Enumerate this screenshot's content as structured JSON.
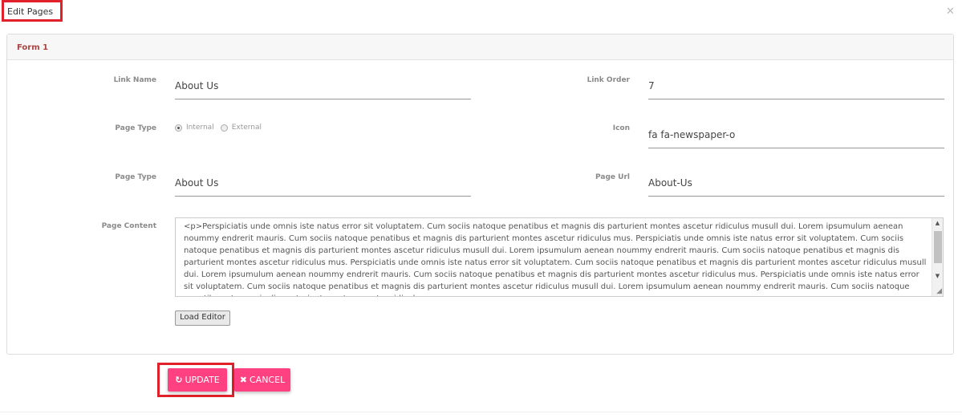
{
  "modal": {
    "title": "Edit Pages",
    "close_icon": "close-icon"
  },
  "panel": {
    "heading": "Form 1"
  },
  "form": {
    "link_name_label": "Link Name",
    "link_name_value": "About Us",
    "link_order_label": "Link Order",
    "link_order_value": "7",
    "page_type_label": "Page Type",
    "page_type_options": [
      "Internal",
      "External"
    ],
    "page_type_selected": "Internal",
    "icon_label": "Icon",
    "icon_value": "fa fa-newspaper-o",
    "page_title_label": "Page Type",
    "page_title_value": "About Us",
    "page_url_label": "Page Url",
    "page_url_value": "About-Us",
    "page_content_label": "Page Content",
    "page_content_value": "<p>Perspiciatis unde omnis iste natus error sit voluptatem. Cum sociis natoque penatibus et magnis dis parturient montes ascetur ridiculus musull dui. Lorem ipsumulum aenean noummy endrerit mauris. Cum sociis natoque penatibus et magnis dis parturient montes ascetur ridiculus mus. Perspiciatis unde omnis iste natus error sit voluptatem. Cum sociis natoque penatibus et magnis dis parturient montes ascetur ridiculus musull dui. Lorem ipsumulum aenean noummy endrerit mauris. Cum sociis natoque penatibus et magnis dis parturient montes ascetur ridiculus mus. Perspiciatis unde omnis iste natus error sit voluptatem. Cum sociis natoque penatibus et magnis dis parturient montes ascetur ridiculus musull dui. Lorem ipsumulum aenean noummy endrerit mauris. Cum sociis natoque penatibus et magnis dis parturient montes ascetur ridiculus mus. Perspiciatis unde omnis iste natus error sit voluptatem. Cum sociis natoque penatibus et magnis dis parturient montes ascetur ridiculus musull dui. Lorem ipsumulum aenean noummy endrerit mauris. Cum sociis natoque penatibus et magnis dis parturient montes ascetur ridiculus mus.",
    "load_editor_label": "Load Editor"
  },
  "actions": {
    "update_label": "UPDATE",
    "update_icon": "refresh-icon",
    "cancel_label": "CANCEL",
    "cancel_icon": "close-icon"
  },
  "colors": {
    "accent": "#ff4081",
    "highlight": "#e0202a",
    "heading": "#a94442"
  }
}
